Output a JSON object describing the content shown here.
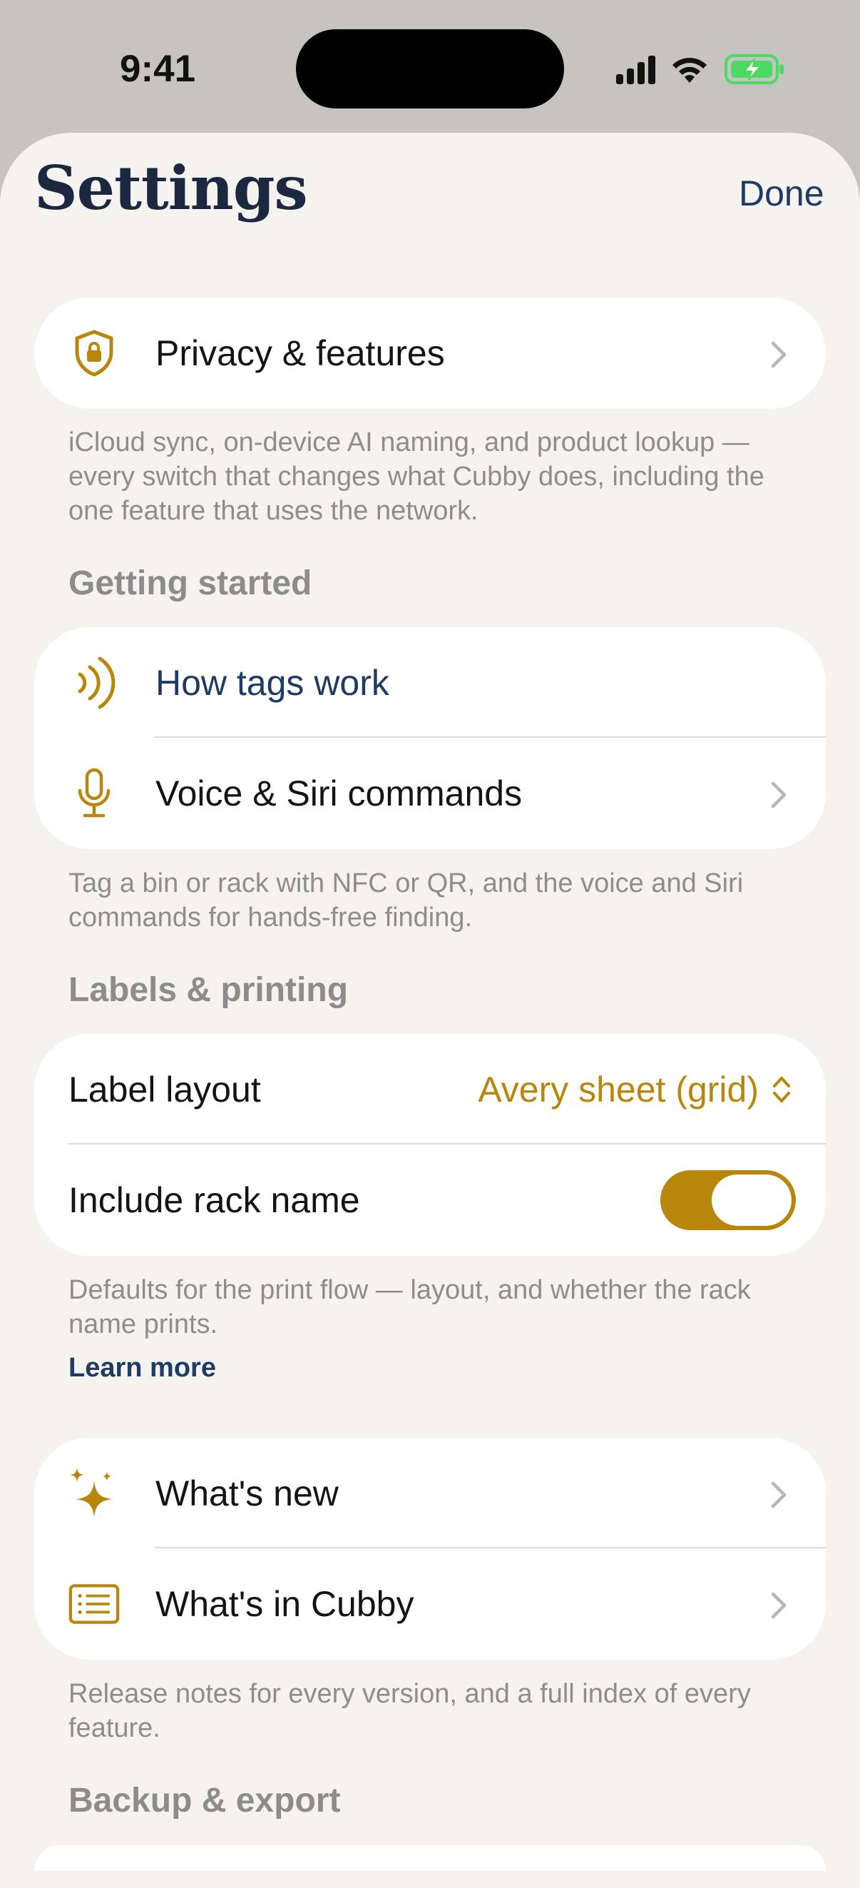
{
  "status_bar": {
    "time": "9:41"
  },
  "header": {
    "title": "Settings",
    "done_label": "Done"
  },
  "privacy": {
    "label": "Privacy & features",
    "icon": "lock-shield-icon",
    "footnote": "iCloud sync, on-device AI naming, and product lookup — every switch that changes what Cubby does, including the one feature that uses the network."
  },
  "getting_started": {
    "header": "Getting started",
    "items": [
      {
        "label": "How tags work",
        "icon": "nfc-waves-icon"
      },
      {
        "label": "Voice & Siri commands",
        "icon": "microphone-icon"
      }
    ],
    "footnote": "Tag a bin or rack with NFC or QR, and the voice and Siri commands for hands-free finding."
  },
  "labels_printing": {
    "header": "Labels & printing",
    "layout_label": "Label layout",
    "layout_value": "Avery sheet (grid)",
    "rack_name_label": "Include rack name",
    "rack_name_on": true,
    "footnote": "Defaults for the print flow — layout, and whether the rack name prints.",
    "learn_more": "Learn more"
  },
  "whats_new": {
    "items": [
      {
        "label": "What's new",
        "icon": "sparkles-icon"
      },
      {
        "label": "What's in Cubby",
        "icon": "list-document-icon"
      }
    ],
    "footnote": "Release notes for every version, and a full index of every feature."
  },
  "backup_export": {
    "header": "Backup & export"
  },
  "colors": {
    "accent_gold": "#b8860b",
    "navy": "#1f3a63",
    "background": "#f4f3ef",
    "battery_green": "#4cd964"
  }
}
